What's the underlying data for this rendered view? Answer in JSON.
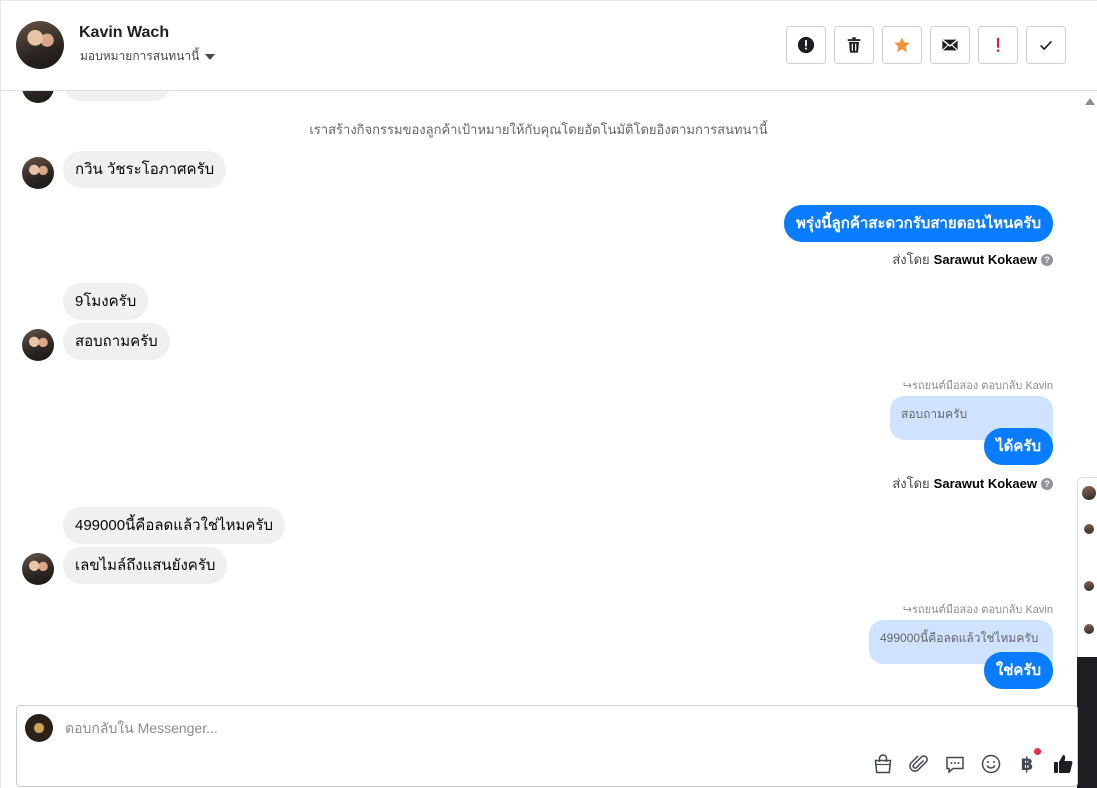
{
  "header": {
    "contact_name": "Kavin Wach",
    "assign_label": "มอบหมายการสนทนานี้"
  },
  "thread": {
    "system_note": "เราสร้างกิจกรรมของลูกค้าเป้าหมายให้กับคุณโดยอัตโนมัติโดยอิงตามการสนทนานี้",
    "messages": [
      {
        "text": "กวิน วัชระโอภาศครับ"
      },
      {
        "text": "พรุ่งนี้ลูกค้าสะดวกรับสายตอนไหนครับ"
      },
      {
        "text": "9โมงครับ"
      },
      {
        "text": "สอบถามครับ"
      },
      {
        "text": "ได้ครับ"
      },
      {
        "text": "499000นี้คือลดแล้วใช่ไหมครับ"
      },
      {
        "text": "เลขไมล์ถึงแสนยังครับ"
      },
      {
        "text": "ใช่ครับ"
      }
    ],
    "quotes": [
      {
        "reply_label": "รถยนต์มือสอง ตอบกลับ Kavin",
        "quoted_text": "สอบถามครับ"
      },
      {
        "reply_label": "รถยนต์มือสอง ตอบกลับ Kavin",
        "quoted_text": "499000นี้คือลดแล้วใช่ไหมครับ"
      }
    ],
    "sent_by": {
      "prefix": "ส่งโดย",
      "name": "Sarawut Kokaew"
    }
  },
  "composer": {
    "placeholder": "ตอบกลับใน Messenger..."
  },
  "colors": {
    "accent": "#0a7cff",
    "incoming_bubble": "#f0f0f0",
    "quote_bubble": "#cfe3ff",
    "notification_dot": "#f02849"
  },
  "icons": {
    "header_actions": [
      "alert-icon",
      "trash-icon",
      "star-icon",
      "envelope-icon",
      "exclamation-icon",
      "check-icon"
    ],
    "composer_tools": [
      "shopping-bag-icon",
      "paperclip-icon",
      "chat-bubble-icon",
      "smiley-icon",
      "baht-icon",
      "thumbs-up-icon"
    ]
  }
}
